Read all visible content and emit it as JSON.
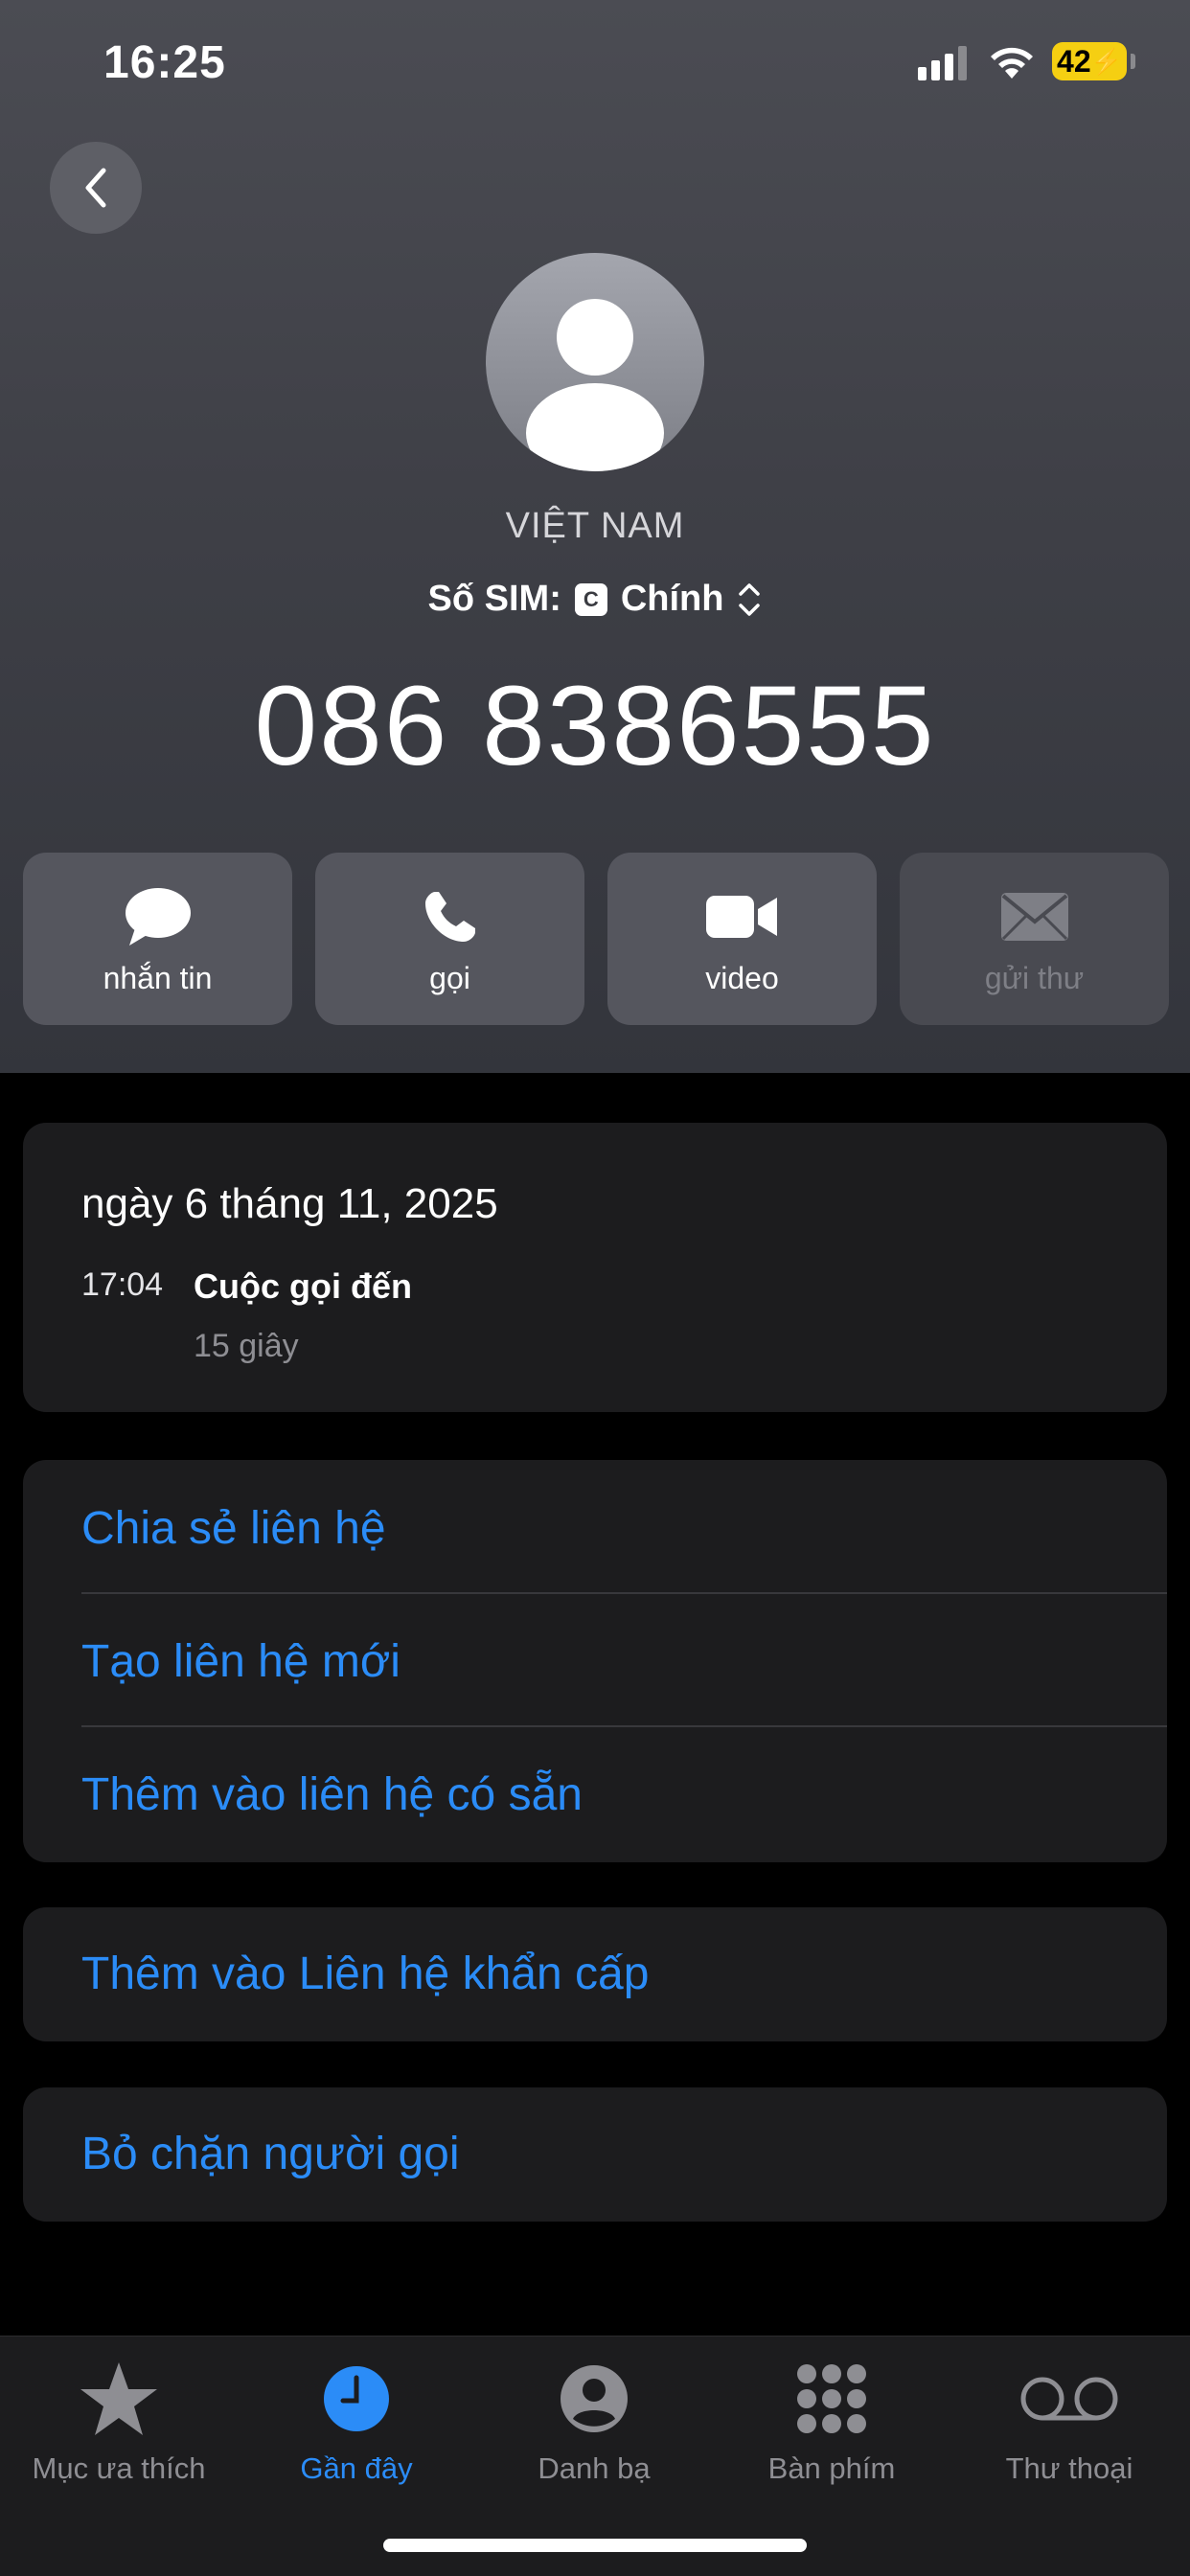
{
  "status": {
    "time": "16:25",
    "battery": "42"
  },
  "contact": {
    "name": "VIỆT NAM",
    "sim_label": "Số SIM:",
    "sim_badge": "C",
    "sim_value": "Chính",
    "number": "086 8386555"
  },
  "actions": [
    {
      "label": "nhắn tin",
      "icon": "message-icon",
      "enabled": true
    },
    {
      "label": "gọi",
      "icon": "phone-icon",
      "enabled": true
    },
    {
      "label": "video",
      "icon": "video-icon",
      "enabled": true
    },
    {
      "label": "gửi thư",
      "icon": "mail-icon",
      "enabled": false
    }
  ],
  "history": {
    "date": "ngày 6 tháng 11, 2025",
    "entries": [
      {
        "time": "17:04",
        "type": "Cuộc gọi đến",
        "duration": "15 giây"
      }
    ]
  },
  "options": [
    "Chia sẻ liên hệ",
    "Tạo liên hệ mới",
    "Thêm vào liên hệ có sẵn"
  ],
  "emergency": "Thêm vào Liên hệ khẩn cấp",
  "unblock": "Bỏ chặn người gọi",
  "tabs": [
    {
      "label": "Mục ưa thích",
      "icon": "star-icon",
      "active": false
    },
    {
      "label": "Gần đây",
      "icon": "clock-icon",
      "active": true
    },
    {
      "label": "Danh bạ",
      "icon": "person-circle-icon",
      "active": false
    },
    {
      "label": "Bàn phím",
      "icon": "keypad-icon",
      "active": false
    },
    {
      "label": "Thư thoại",
      "icon": "voicemail-icon",
      "active": false
    }
  ],
  "colors": {
    "accent": "#2b8cf7",
    "battery": "#f5cf12",
    "card": "#1c1c1e"
  }
}
